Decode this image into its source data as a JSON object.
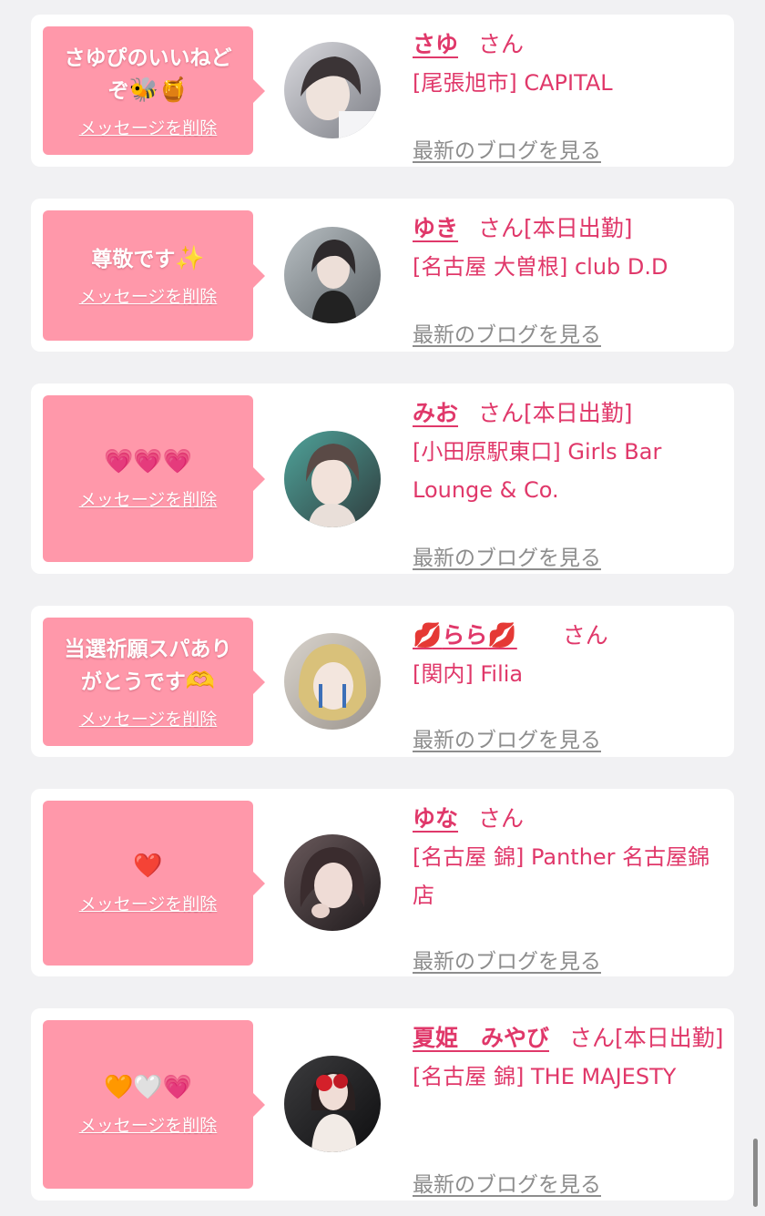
{
  "delete_label": "メッセージを削除",
  "blog_label": "最新のブログを見る",
  "honorific": "さん",
  "colors": {
    "background": "#f1f1f3",
    "bubble": "#ff98aa",
    "accent": "#e0386a",
    "link_gray": "#8d8d8d"
  },
  "items": [
    {
      "message": "さゆぴのいいねど",
      "message2": "ぞ",
      "message_emoji": "🐝🍯",
      "name": "さゆ",
      "status": "",
      "shop": "[尾張旭市] CAPITAL",
      "avatar_icon": "avatar-photo"
    },
    {
      "message": "尊敬です",
      "message_emoji": "✨",
      "name": "ゆき",
      "status": "[本日出勤]",
      "shop": "[名古屋 大曽根] club D.D",
      "avatar_icon": "avatar-photo"
    },
    {
      "message": "",
      "message_emoji": "💗💗💗",
      "name": "みお",
      "status": "[本日出勤]",
      "shop": "[小田原駅東口] Girls Bar Lounge & Co.",
      "avatar_icon": "avatar-photo"
    },
    {
      "message": "当選祈願スパあり",
      "message2": "がとうです",
      "message_emoji": "🫶",
      "name_emoji": "💋",
      "name": "らら",
      "status": "",
      "shop": "[関内] Filia",
      "avatar_icon": "avatar-photo"
    },
    {
      "message": "",
      "message_emoji": "❤️",
      "name": "ゆな",
      "status": "",
      "shop": "[名古屋 錦] Panther 名古屋錦店",
      "avatar_icon": "avatar-photo"
    },
    {
      "message": "",
      "message_emoji": "🧡🤍💗",
      "name": "夏姫　みやび",
      "status": "[本日出勤]",
      "shop": "[名古屋 錦] THE MAJESTY",
      "avatar_icon": "avatar-photo"
    }
  ]
}
